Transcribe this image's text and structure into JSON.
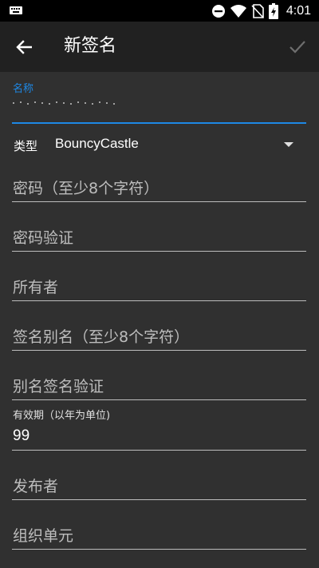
{
  "status_bar": {
    "time": "4:01",
    "icons": [
      "keyboard-icon",
      "do-not-disturb-icon",
      "wifi-icon",
      "no-sim-icon",
      "battery-charging-icon"
    ]
  },
  "toolbar": {
    "title": "新签名",
    "back_icon": "arrow-left-icon",
    "confirm_icon": "check-icon"
  },
  "form": {
    "name": {
      "label": "名称",
      "value": ""
    },
    "type": {
      "label": "类型",
      "value": "BouncyCastle"
    },
    "password": {
      "placeholder": "密码（至少8个字符）"
    },
    "password_confirm": {
      "placeholder": "密码验证"
    },
    "owner": {
      "placeholder": "所有者"
    },
    "alias": {
      "placeholder": "签名别名（至少8个字符）"
    },
    "alias_confirm": {
      "placeholder": "别名签名验证"
    },
    "validity": {
      "label": "有效期（以年为单位)",
      "value": "99"
    },
    "issuer": {
      "placeholder": "发布者"
    },
    "org_unit": {
      "placeholder": "组织单元"
    }
  },
  "colors": {
    "background": "#303030",
    "toolbar": "#212121",
    "accent": "#1e88e5",
    "hint": "#bdbdbd"
  }
}
